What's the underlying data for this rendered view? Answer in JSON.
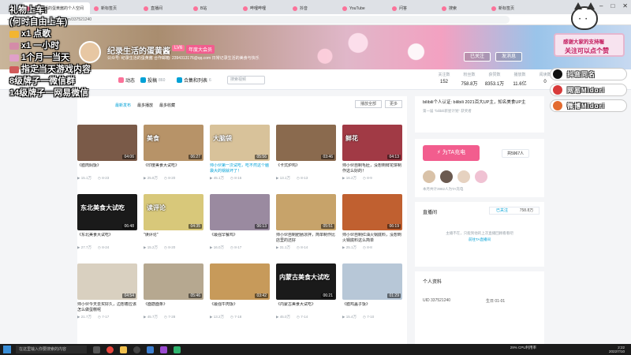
{
  "browser": {
    "tabs": [
      {
        "label": "纪录生活的蛋黄酱的个人空间",
        "active": true
      },
      {
        "label": "新标签页"
      },
      {
        "label": "直播间"
      },
      {
        "label": "B站"
      },
      {
        "label": "哔哩哔哩"
      },
      {
        "label": "抖音"
      },
      {
        "label": "YouTube"
      },
      {
        "label": "问答"
      },
      {
        "label": "搜索"
      },
      {
        "label": "新标签页"
      }
    ],
    "url": "space.bilibili.com/337521240"
  },
  "profile": {
    "name": "纪录生活的蛋黄酱",
    "level": "LV6",
    "badge": "年度大会员",
    "sign": "公众号: 纪录生活的蛋黄酱 合作邮箱: 2394313176@qq.com 日常记录生活的美食与快乐",
    "follow_label": "已关注",
    "message_label": "发消息"
  },
  "nav": {
    "dynamic": "动态",
    "contribute": "投稿",
    "contribute_count": "860",
    "collections": "合集和列表",
    "collections_count": "6",
    "search_placeholder": "搜索视频"
  },
  "stats": [
    {
      "label": "关注数",
      "value": "152"
    },
    {
      "label": "粉丝数",
      "value": "758.8万"
    },
    {
      "label": "获赞数",
      "value": "8353.1万"
    },
    {
      "label": "播放数",
      "value": "11.6亿"
    },
    {
      "label": "阅读数",
      "value": "0"
    }
  ],
  "sort": {
    "latest": "最新发布",
    "most_played": "最多播放",
    "most_favorited": "最多收藏",
    "play_all": "播放全部",
    "more": "更多"
  },
  "videos": [
    {
      "title": "《腊肉焖饭》",
      "views": "15.1万",
      "date": "8-23",
      "dur": "04:06",
      "color": "#7a5a48",
      "cap": ""
    },
    {
      "title": "《印度美食大试吃》",
      "views": "25.8万",
      "date": "8-20",
      "dur": "06:27",
      "color": "#b79368",
      "cap": "美食"
    },
    {
      "title": "帅小伙第一次试吃，吃不然这个脑袋大的锅就坏了！",
      "views": "45.1万",
      "date": "8-16",
      "dur": "05:56",
      "color": "#d8c29a",
      "cap": "大脑袋"
    },
    {
      "title": "《卡式炉鸡》",
      "views": "13.1万",
      "date": "8-13",
      "dur": "03:46",
      "color": "#8a6a4e",
      "cap": ""
    },
    {
      "title": "帅小伙自制毛肚，没想到鲜花饼制作这么好的！",
      "views": "16.2万",
      "date": "8-9",
      "dur": "04:13",
      "color": "#a13a45",
      "cap": "鲜花"
    },
    {
      "title": "《东北美食大试吃》",
      "views": "27.7万",
      "date": "8-24",
      "dur": "06:48",
      "color": "#1a1a1a",
      "cap": "东北美食大试吃"
    },
    {
      "title": "\"读评论\"",
      "views": "15.2万",
      "date": "8-20",
      "dur": "04:35",
      "color": "#d8c87a",
      "cap": "读评论"
    },
    {
      "title": "《最强早餐鸡》",
      "views": "16.0万",
      "date": "8-17",
      "dur": "06:13",
      "color": "#9a8aa0",
      "cap": ""
    },
    {
      "title": "帅小伙自制肥肠凉拌，简单制作比店里的还好",
      "views": "31.1万",
      "date": "8-14",
      "dur": "05:51",
      "color": "#c7a36a",
      "cap": ""
    },
    {
      "title": "帅小伙自制红油火锅底料，没想到火锅底料这么简单",
      "views": "25.1万",
      "date": "8-8",
      "dur": "06:19",
      "color": "#c06030",
      "cap": ""
    },
    {
      "title": "帅小伙今天去买好久，边想着应该怎么做蛋糕呢",
      "views": "21.7万",
      "date": "7-17",
      "dur": "04:54",
      "color": "#d9d0c0",
      "cap": ""
    },
    {
      "title": "《面筋面条》",
      "views": "45.7万",
      "date": "7-28",
      "dur": "05:46",
      "color": "#b6a890",
      "cap": ""
    },
    {
      "title": "《最强牛肉饭》",
      "views": "13.2万",
      "date": "7-18",
      "dur": "03:42",
      "color": "#c79a5a",
      "cap": ""
    },
    {
      "title": "《内蒙古美食大试吃》",
      "views": "45.0万",
      "date": "7-14",
      "dur": "06:21",
      "color": "#1a1a1a",
      "cap": "内蒙古美食大试吃"
    },
    {
      "title": "《腊鸡盖子饭》",
      "views": "15.4万",
      "date": "7-10",
      "dur": "01:29",
      "color": "#b7c7d7",
      "cap": ""
    }
  ],
  "side": {
    "cert": "bilibili个人认证: bilibili 2021百大UP主，知名美食UP主",
    "cert_sub": "第一届 \"bilibili新星计划\" 获奖者",
    "charge_label": "为TA充电",
    "charge_count": "共5967人",
    "charge_note": "本月共计3982人为TA充电",
    "live_head": "直播间",
    "live_tab_on": "已关注",
    "live_tab_off": "758.8万",
    "live_empty": "主播不在，只能到他的上次直播回顾看看吧",
    "live_link": "前往TA直播间",
    "info_head": "个人资料",
    "uid_label": "UID",
    "uid": "337521240",
    "bday_label": "生日",
    "bday": "01-01"
  },
  "overlay": {
    "lines": [
      {
        "text": "礼物上车:",
        "gift": ""
      },
      {
        "text": "(何时自由上车)",
        "gift": ""
      },
      {
        "text": "x1 点歌",
        "gift": "#f2b531"
      },
      {
        "text": "x1 一小时",
        "gift": "#d48ca8"
      },
      {
        "text": "1个月一当天",
        "gift": "#e0a0c8"
      },
      {
        "text": "指定当天游戏内容",
        "gift": "#d05a5a"
      },
      {
        "text": "8级牌子一微信群",
        "gift": ""
      },
      {
        "text": "14级牌子一网易微信",
        "gift": ""
      }
    ],
    "mini1": "感谢大家的支持喔",
    "mini2": "关注可以点个赞",
    "social": [
      {
        "label": "抖音同名",
        "color": "#111111"
      },
      {
        "label": "网易Midori",
        "color": "#d83b3b"
      },
      {
        "label": "微博Midori",
        "color": "#e36b2f"
      }
    ]
  },
  "taskbar": {
    "search": "在这里输入你要搜索的内容",
    "time": "2:22",
    "date": "2022/7/10",
    "sys": "29% CPU利用率"
  }
}
